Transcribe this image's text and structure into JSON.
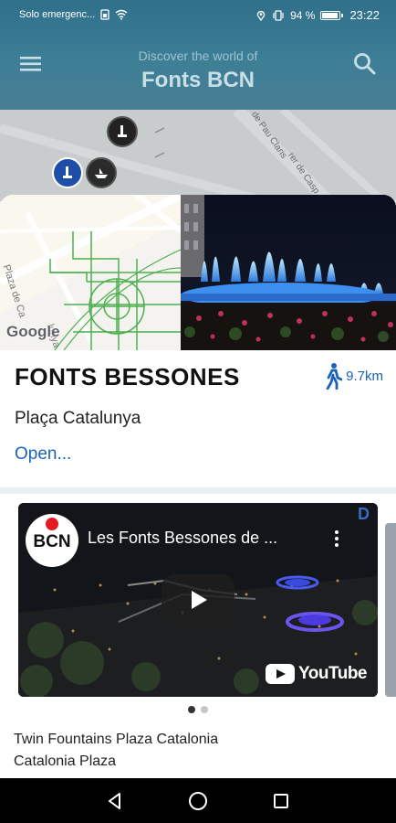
{
  "status_bar": {
    "carrier": "Solo emergenc...",
    "battery_pct": "94 %",
    "time": "23:22",
    "icons": [
      "sim-icon",
      "wifi-icon",
      "location-icon",
      "vibrate-icon",
      "battery-icon"
    ]
  },
  "header": {
    "subtitle": "Discover the world of",
    "title": "Fonts BCN",
    "menu_icon": "menu-icon",
    "search_icon": "search-icon",
    "gradient_top": "#2f6f8b",
    "gradient_bottom": "#497d93"
  },
  "map": {
    "streets": [
      "de Pau Claris",
      "rer de Casp"
    ]
  },
  "card": {
    "map_attribution": "Google",
    "name": "FONTS BESSONES",
    "distance": "9.7km",
    "distance_icon": "walking-icon",
    "location": "Plaça Catalunya",
    "open_label": "Open...",
    "map_streets": [
      "Plaza de Ca",
      "lunya"
    ],
    "accent_color": "#1a62b9"
  },
  "videos": {
    "channel_logo": "BCN",
    "title": "Les Fonts Bessones de ...",
    "provider": "YouTube",
    "peek_label": "D",
    "page_count": 2,
    "active_page": 0,
    "caption_lines": [
      "Twin Fountains Plaza Catalonia",
      "Catalonia Plaza"
    ]
  },
  "navbar": {
    "icons": [
      "back-icon",
      "home-icon",
      "recents-icon"
    ]
  }
}
